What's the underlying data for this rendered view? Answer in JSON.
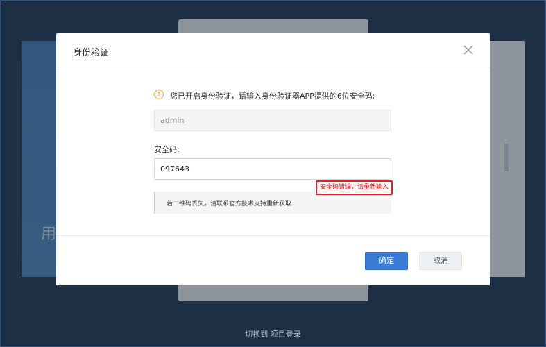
{
  "background": {
    "left_card_text": "用",
    "switch_link": "切换到 项目登录"
  },
  "modal": {
    "title": "身份验证",
    "info_text": "您已开启身份验证，请输入身份验证器APP提供的6位安全码:",
    "username_value": "admin",
    "code_label": "安全码:",
    "code_value": "097643",
    "error_text": "安全码错误，请重新输入",
    "hint_text": "若二维码丢失，请联系官方技术支持重新获取",
    "ok_label": "确定",
    "cancel_label": "取消"
  },
  "colors": {
    "primary": "#3a7bd5",
    "error": "#e02020",
    "warning": "#f5a623",
    "backdrop": "#112a47"
  }
}
